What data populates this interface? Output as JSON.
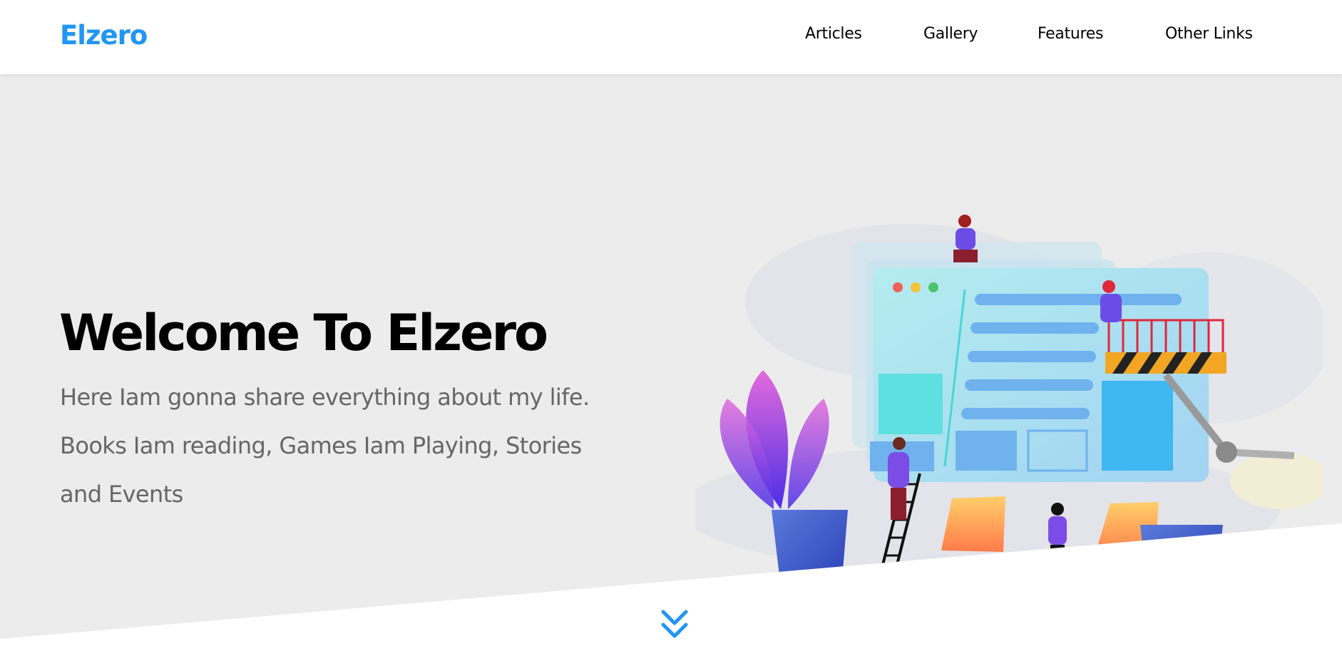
{
  "header": {
    "logo": "Elzero",
    "nav": [
      {
        "label": "Articles"
      },
      {
        "label": "Gallery"
      },
      {
        "label": "Features"
      },
      {
        "label": "Other Links"
      }
    ]
  },
  "hero": {
    "title": "Welcome To Elzero",
    "text": "Here Iam gonna share everything about my life. Books Iam reading, Games Iam Playing, Stories and Events",
    "illustration_icon": "website-building-illustration"
  },
  "scroll_icon": "double-chevron-down-icon",
  "colors": {
    "brand": "#2196f3",
    "hero_bg": "#ececec",
    "text_muted": "#666666"
  }
}
